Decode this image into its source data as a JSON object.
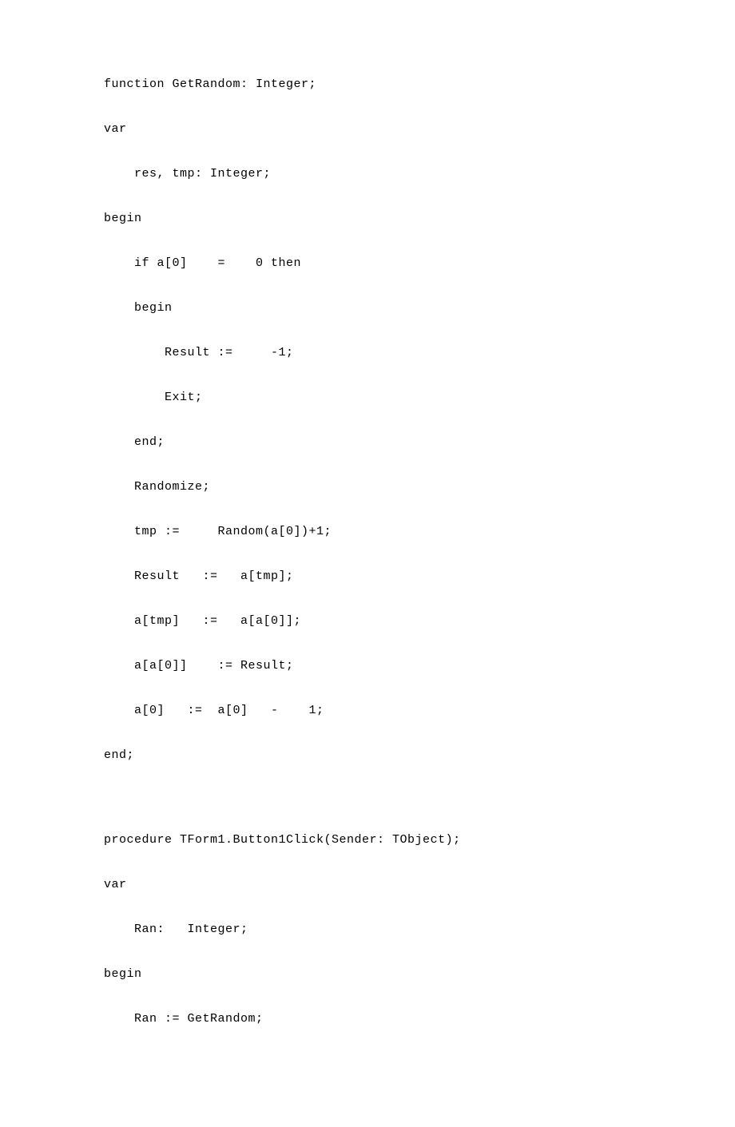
{
  "code": {
    "lines": [
      "function GetRandom: Integer;",
      "var",
      "    res, tmp: Integer;",
      "begin",
      "    if a[0]    =    0 then",
      "    begin",
      "        Result :=     -1;",
      "        Exit;",
      "    end;",
      "    Randomize;",
      "    tmp :=     Random(a[0])+1;",
      "    Result   :=   a[tmp];",
      "    a[tmp]   :=   a[a[0]];",
      "    a[a[0]]    := Result;",
      "    a[0]   :=  a[0]   -    1;",
      "end;",
      "",
      "procedure TForm1.Button1Click(Sender: TObject);",
      "var",
      "    Ran:   Integer;",
      "begin",
      "    Ran := GetRandom;"
    ]
  }
}
